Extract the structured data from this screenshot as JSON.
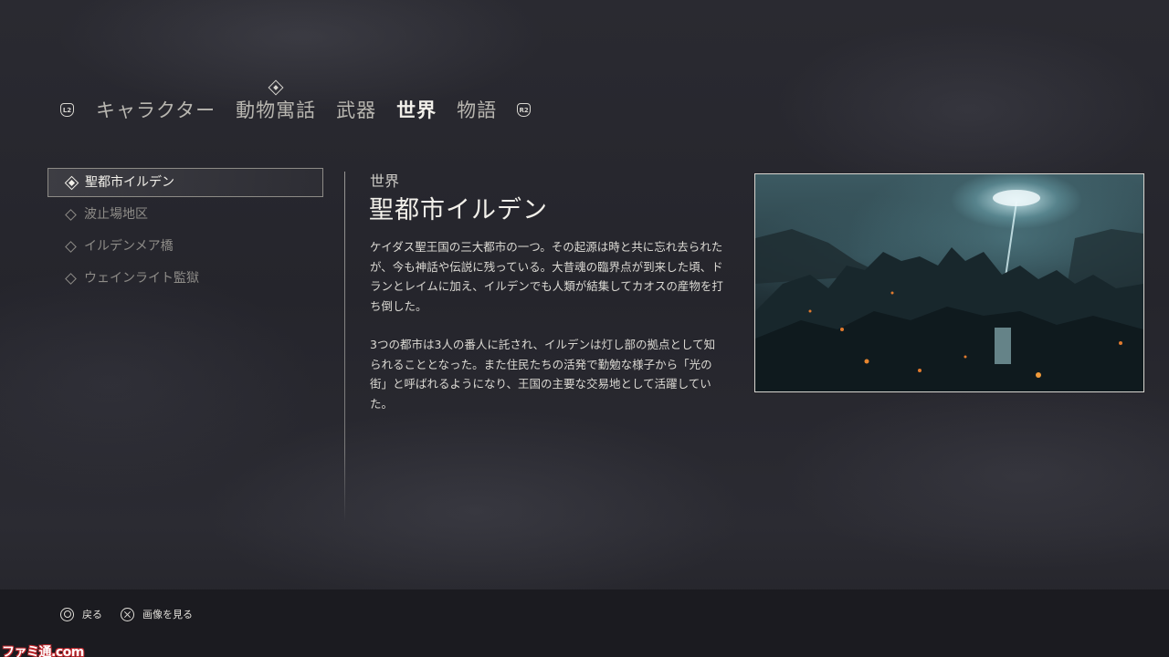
{
  "tabs": {
    "left_shoulder": "L2",
    "right_shoulder": "R2",
    "items": [
      {
        "label": "キャラクター"
      },
      {
        "label": "動物寓話"
      },
      {
        "label": "武器"
      },
      {
        "label": "世界",
        "active": true
      },
      {
        "label": "物語"
      }
    ]
  },
  "list": {
    "items": [
      {
        "label": "聖都市イルデン",
        "selected": true
      },
      {
        "label": "波止場地区"
      },
      {
        "label": "イルデンメア橋"
      },
      {
        "label": "ウェインライト監獄"
      }
    ]
  },
  "detail": {
    "category": "世界",
    "title": "聖都市イルデン",
    "paragraphs": [
      "ケイダス聖王国の三大都市の一つ。その起源は時と共に忘れ去られたが、今も神話や伝説に残っている。大昔魂の臨界点が到来した頃、ドランとレイムに加え、イルデンでも人類が結集してカオスの産物を打ち倒した。",
      "3つの都市は3人の番人に託され、イルデンは灯し部の拠点として知られることとなった。また住民たちの活発で勤勉な様子から「光の街」と呼ばれるようになり、王国の主要な交易地として活躍していた。"
    ],
    "image_subject": "city-artwork"
  },
  "footer": {
    "back_label": "戻る",
    "view_image_label": "画像を見る"
  },
  "watermark": "ファミ通.com"
}
